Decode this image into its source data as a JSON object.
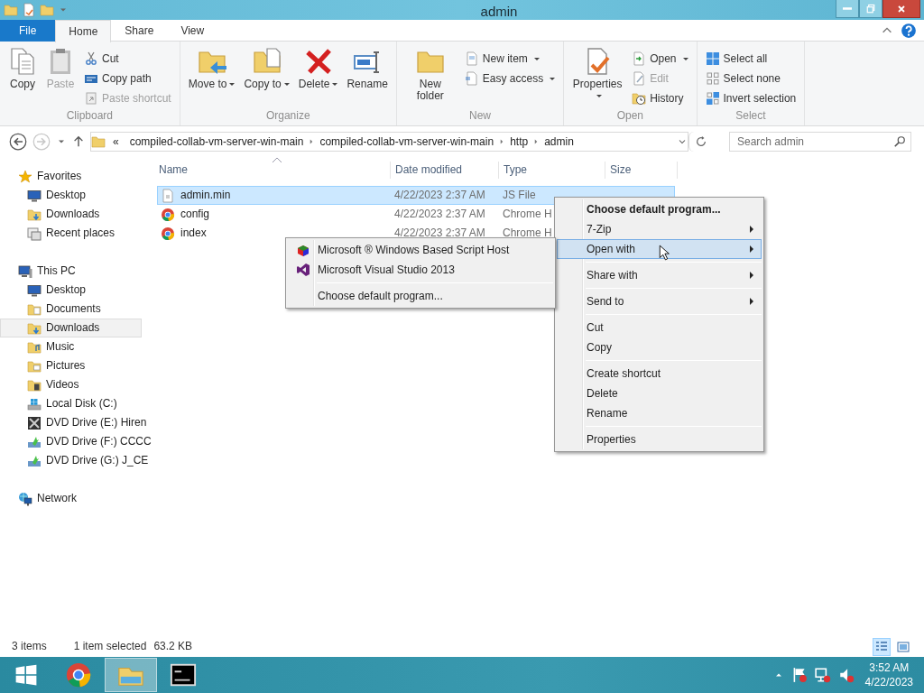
{
  "window": {
    "title": "admin"
  },
  "ribbon_tabs": [
    {
      "label": "File",
      "kind": "file",
      "selected": false
    },
    {
      "label": "Home",
      "kind": "tab",
      "selected": true
    },
    {
      "label": "Share",
      "kind": "tab",
      "selected": false
    },
    {
      "label": "View",
      "kind": "tab",
      "selected": false
    }
  ],
  "ribbon_groups": [
    {
      "label": "Clipboard",
      "buttons": [
        {
          "label": "Copy",
          "kind": "large",
          "disabled": false,
          "dropdown": false
        },
        {
          "label": "Paste",
          "kind": "large",
          "disabled": true,
          "dropdown": false
        },
        {
          "label": "Cut",
          "kind": "small",
          "disabled": false,
          "dropdown": false
        },
        {
          "label": "Copy path",
          "kind": "small",
          "disabled": false,
          "dropdown": false
        },
        {
          "label": "Paste shortcut",
          "kind": "small",
          "disabled": true,
          "dropdown": false
        }
      ]
    },
    {
      "label": "Organize",
      "buttons": [
        {
          "label": "Move to",
          "kind": "large",
          "disabled": false,
          "dropdown": true
        },
        {
          "label": "Copy to",
          "kind": "large",
          "disabled": false,
          "dropdown": true
        },
        {
          "label": "Delete",
          "kind": "large",
          "disabled": false,
          "dropdown": true
        },
        {
          "label": "Rename",
          "kind": "large",
          "disabled": false,
          "dropdown": false
        }
      ]
    },
    {
      "label": "New",
      "buttons": [
        {
          "label": "New folder",
          "kind": "large",
          "disabled": false,
          "dropdown": false
        },
        {
          "label": "New item",
          "kind": "small",
          "disabled": false,
          "dropdown": true
        },
        {
          "label": "Easy access",
          "kind": "small",
          "disabled": false,
          "dropdown": true
        }
      ]
    },
    {
      "label": "Open",
      "buttons": [
        {
          "label": "Properties",
          "kind": "large",
          "disabled": false,
          "dropdown": true
        },
        {
          "label": "Open",
          "kind": "small",
          "disabled": false,
          "dropdown": true
        },
        {
          "label": "Edit",
          "kind": "small",
          "disabled": true,
          "dropdown": false
        },
        {
          "label": "History",
          "kind": "small",
          "disabled": false,
          "dropdown": false
        }
      ]
    },
    {
      "label": "Select",
      "buttons": [
        {
          "label": "Select all",
          "kind": "small",
          "disabled": false,
          "dropdown": false
        },
        {
          "label": "Select none",
          "kind": "small",
          "disabled": false,
          "dropdown": false
        },
        {
          "label": "Invert selection",
          "kind": "small",
          "disabled": false,
          "dropdown": false
        }
      ]
    }
  ],
  "address": {
    "back_disabled": false,
    "forward_disabled": true,
    "overflow": "«",
    "crumbs": [
      "compiled-collab-vm-server-win-main",
      "compiled-collab-vm-server-win-main",
      "http",
      "admin"
    ]
  },
  "search": {
    "placeholder": "Search admin"
  },
  "nav": [
    {
      "label": "Favorites",
      "kind": "favorites",
      "selected": false,
      "children": [
        {
          "label": "Desktop",
          "kind": "desktop",
          "selected": false
        },
        {
          "label": "Downloads",
          "kind": "downloads",
          "selected": false
        },
        {
          "label": "Recent places",
          "kind": "recent",
          "selected": false
        }
      ]
    },
    {
      "label": "This PC",
      "kind": "pc",
      "selected": false,
      "children": [
        {
          "label": "Desktop",
          "kind": "desktop",
          "selected": false
        },
        {
          "label": "Documents",
          "kind": "documents",
          "selected": false
        },
        {
          "label": "Downloads",
          "kind": "downloads",
          "selected": true
        },
        {
          "label": "Music",
          "kind": "music",
          "selected": false
        },
        {
          "label": "Pictures",
          "kind": "pictures",
          "selected": false
        },
        {
          "label": "Videos",
          "kind": "videos",
          "selected": false
        },
        {
          "label": "Local Disk (C:)",
          "kind": "disk",
          "selected": false
        },
        {
          "label": "DVD Drive (E:) Hiren",
          "kind": "tools-drive",
          "selected": false
        },
        {
          "label": "DVD Drive (F:) CCCC",
          "kind": "dvd",
          "selected": false
        },
        {
          "label": "DVD Drive (G:) J_CE",
          "kind": "dvd",
          "selected": false
        }
      ]
    },
    {
      "label": "Network",
      "kind": "network",
      "selected": false
    }
  ],
  "columns": [
    {
      "label": "Name",
      "sorted": true
    },
    {
      "label": "Date modified",
      "sorted": false
    },
    {
      "label": "Type",
      "sorted": false
    },
    {
      "label": "Size",
      "sorted": false
    }
  ],
  "files": [
    {
      "name": "admin.min",
      "date": "4/22/2023 2:37 AM",
      "type": "JS File",
      "kind": "script",
      "selected": true
    },
    {
      "name": "config",
      "date": "4/22/2023 2:37 AM",
      "type": "Chrome H",
      "kind": "web",
      "selected": false
    },
    {
      "name": "index",
      "date": "4/22/2023 2:37 AM",
      "type": "Chrome H",
      "kind": "web",
      "selected": false
    }
  ],
  "context_menu": {
    "groups": [
      {
        "items": [
          {
            "label": "Choose default program...",
            "default": true,
            "submenu": false,
            "selected": false
          },
          {
            "label": "7-Zip",
            "default": false,
            "submenu": true,
            "selected": false
          },
          {
            "label": "Open with",
            "default": false,
            "submenu": true,
            "selected": true
          }
        ]
      },
      {
        "items": [
          {
            "label": "Share with",
            "default": false,
            "submenu": true,
            "selected": false
          }
        ]
      },
      {
        "items": [
          {
            "label": "Send to",
            "default": false,
            "submenu": true,
            "selected": false
          }
        ]
      },
      {
        "items": [
          {
            "label": "Cut",
            "default": false,
            "submenu": false,
            "selected": false
          },
          {
            "label": "Copy",
            "default": false,
            "submenu": false,
            "selected": false
          }
        ]
      },
      {
        "items": [
          {
            "label": "Create shortcut",
            "default": false,
            "submenu": false,
            "selected": false
          },
          {
            "label": "Delete",
            "default": false,
            "submenu": false,
            "selected": false
          },
          {
            "label": "Rename",
            "default": false,
            "submenu": false,
            "selected": false
          }
        ]
      },
      {
        "items": [
          {
            "label": "Properties",
            "default": false,
            "submenu": false,
            "selected": false
          }
        ]
      }
    ]
  },
  "open_with_menu": {
    "groups": [
      {
        "items": [
          {
            "label": "Microsoft ® Windows Based Script Host",
            "kind": "script-host"
          },
          {
            "label": "Microsoft Visual Studio 2013",
            "kind": "visual-studio"
          }
        ]
      },
      {
        "items": [
          {
            "label": "Choose default program...",
            "kind": "plain"
          }
        ]
      }
    ]
  },
  "status_bar": {
    "item_count": "3 items",
    "selection": "1 item selected",
    "size": "63.2 KB"
  },
  "view_buttons": [
    {
      "kind": "details",
      "selected": true
    },
    {
      "kind": "large-icons",
      "selected": false
    }
  ],
  "taskbar": {
    "apps": [
      {
        "kind": "browser",
        "active": false
      },
      {
        "kind": "explorer",
        "active": true
      },
      {
        "kind": "terminal",
        "active": false
      }
    ],
    "time": "3:52 AM",
    "date": "4/22/2023"
  }
}
